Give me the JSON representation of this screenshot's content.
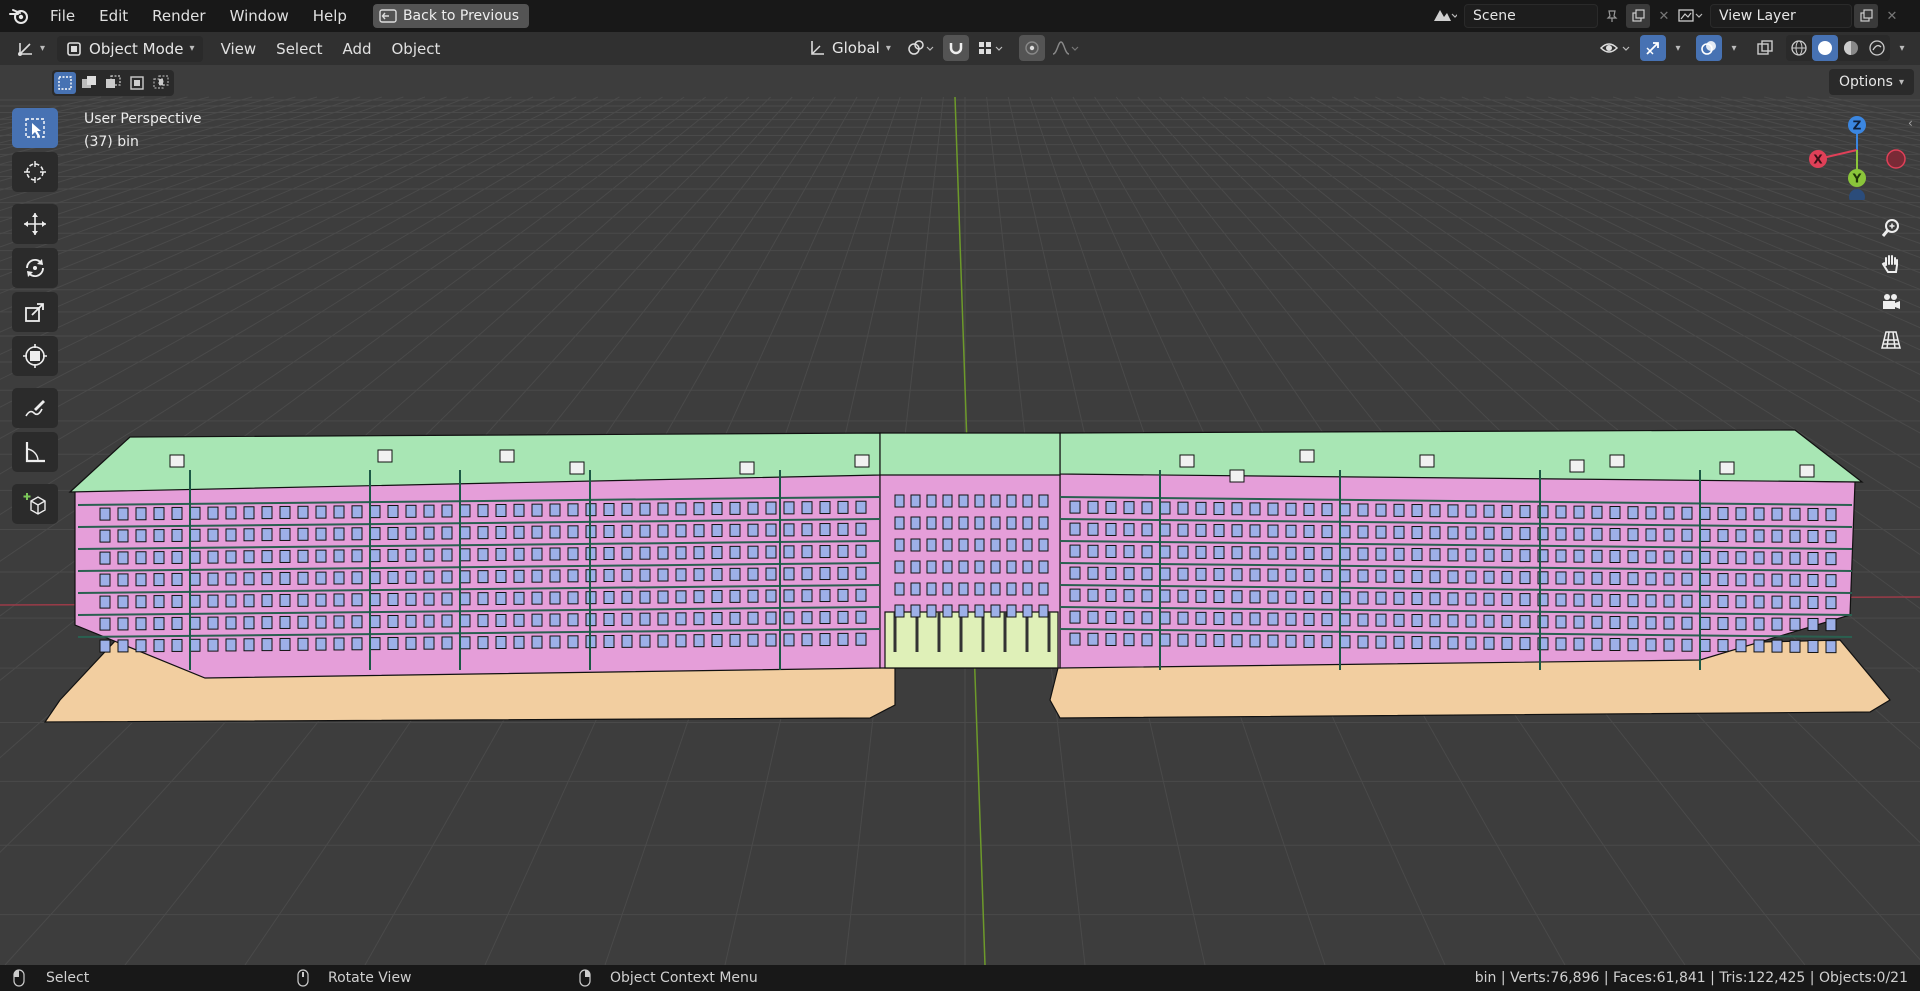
{
  "menubar": {
    "items": [
      "File",
      "Edit",
      "Render",
      "Window",
      "Help"
    ],
    "back_button": "Back to Previous",
    "scene_name": "Scene",
    "view_layer_name": "View Layer"
  },
  "header": {
    "mode": "Object Mode",
    "menus": [
      "View",
      "Select",
      "Add",
      "Object"
    ],
    "transform_orientation": "Global"
  },
  "viewport": {
    "perspective_label": "User Perspective",
    "object_label": "(37) bin",
    "options_label": "Options",
    "gizmo_axes": {
      "x": "X",
      "y": "Y",
      "z": "Z"
    }
  },
  "statusbar": {
    "left": [
      {
        "label": "Select"
      },
      {
        "label": "Rotate View"
      },
      {
        "label": "Object Context Menu"
      }
    ],
    "stats": "bin | Verts:76,896 | Faces:61,841 | Tris:122,425 | Objects:0/21"
  },
  "colors": {
    "accent": "#4772b3",
    "axis_x": "#e04058",
    "axis_y": "#8ac53a",
    "axis_z": "#3b86e0",
    "facade": "#e59ed9",
    "roof": "#a8e6b4",
    "ground": "#f2cea0"
  }
}
